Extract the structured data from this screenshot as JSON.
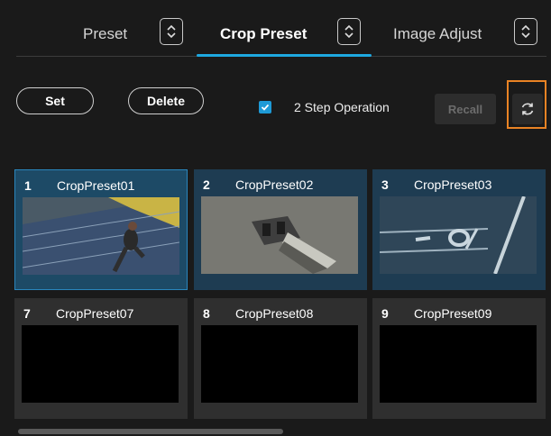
{
  "tabs": [
    {
      "label": "Preset"
    },
    {
      "label": "Crop Preset"
    },
    {
      "label": "Image Adjust"
    }
  ],
  "toolbar": {
    "set_label": "Set",
    "delete_label": "Delete",
    "two_step_label": "2 Step Operation",
    "two_step_checked": true,
    "recall_label": "Recall",
    "refresh_icon": "refresh-icon"
  },
  "presets": [
    {
      "num": "1",
      "name": "CropPreset01",
      "thumb": "runner-on-track"
    },
    {
      "num": "2",
      "name": "CropPreset02",
      "thumb": "starting-block"
    },
    {
      "num": "3",
      "name": "CropPreset03",
      "thumb": "track-lane-number"
    },
    {
      "num": "7",
      "name": "CropPreset07",
      "thumb": "empty"
    },
    {
      "num": "8",
      "name": "CropPreset08",
      "thumb": "empty"
    },
    {
      "num": "9",
      "name": "CropPreset09",
      "thumb": "empty"
    }
  ],
  "colors": {
    "accent": "#1ea8e0",
    "selected_tile": "#1d4a66",
    "highlight": "#e98324"
  }
}
